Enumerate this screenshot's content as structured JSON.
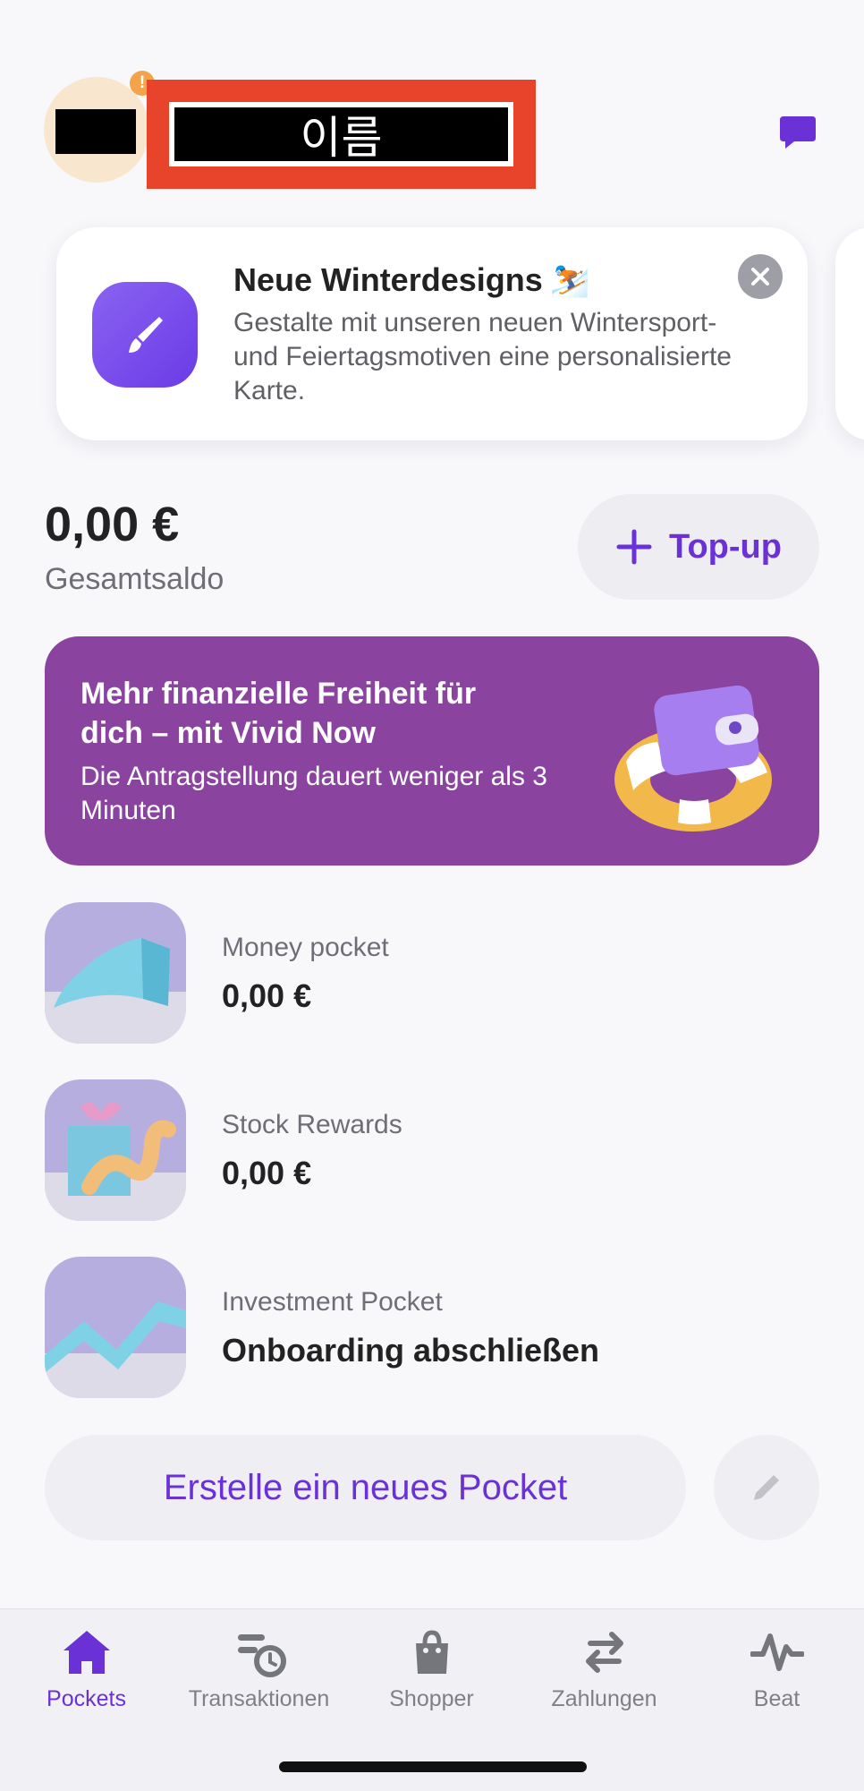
{
  "header": {
    "name_placeholder": "이름",
    "badge_symbol": "!"
  },
  "promo": {
    "title": "Neue Winterdesigns",
    "emoji": "⛷️",
    "text": "Gestalte mit unseren neuen Wintersport- und Feiertagsmotiven eine personalisierte Karte."
  },
  "balance": {
    "amount": "0,00 €",
    "label": "Gesamtsaldo",
    "topup_label": "Top-up"
  },
  "vivid_banner": {
    "title": "Mehr finanzielle Freiheit für dich – mit Vivid Now",
    "subtitle": "Die Antragstellung dauert weniger als 3 Minuten"
  },
  "pockets": [
    {
      "label": "Money pocket",
      "value": "0,00 €"
    },
    {
      "label": "Stock Rewards",
      "value": "0,00 €"
    },
    {
      "label": "Investment Pocket",
      "value": "Onboarding abschließen"
    }
  ],
  "create_pocket_label": "Erstelle ein neues Pocket",
  "tabs": [
    {
      "label": "Pockets",
      "icon": "home-icon",
      "active": true
    },
    {
      "label": "Transaktionen",
      "icon": "transactions-icon",
      "active": false
    },
    {
      "label": "Shopper",
      "icon": "shopping-bag-icon",
      "active": false
    },
    {
      "label": "Zahlungen",
      "icon": "transfer-arrows-icon",
      "active": false
    },
    {
      "label": "Beat",
      "icon": "pulse-icon",
      "active": false
    }
  ],
  "colors": {
    "accent": "#6a32d6",
    "banner": "#8a44a0",
    "redaction_frame": "#e8432b",
    "background": "#f8f7fa"
  }
}
